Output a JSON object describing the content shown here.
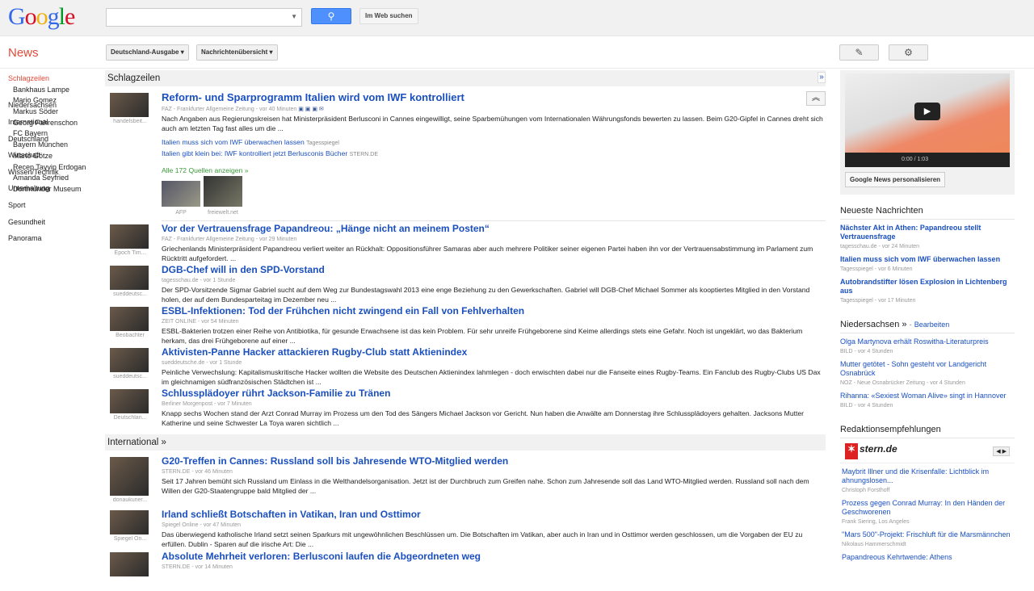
{
  "header": {
    "logo": "Google",
    "search_value": "",
    "search_button_icon": "search-icon",
    "web_search_label": "Im Web suchen"
  },
  "subbar": {
    "app_title": "News",
    "edition_label": "Deutschland-Ausgabe",
    "view_label": "Nachrichtenübersicht",
    "edit_icon": "pencil-icon",
    "settings_icon": "gear-icon"
  },
  "nav": {
    "selected": "Schlagzeilen",
    "subitems": [
      "Bankhaus Lampe",
      "Mario Gomez",
      "Markus Söder",
      "Georg Fahrenschon",
      "FC Bayern",
      "Bayern München",
      "Mario Götze",
      "Recep Tayyip Erdogan",
      "Amanda Seyfried",
      "Dortmunder Museum"
    ],
    "sections": [
      "Niedersachsen",
      "International",
      "Deutschland",
      "Wirtschaft",
      "Wissen/Technik",
      "Unterhaltung",
      "Sport",
      "Gesundheit",
      "Panorama"
    ]
  },
  "headlines": {
    "title": "Schlagzeilen",
    "more": "»",
    "lead": {
      "thumb_caption": "handelsbeit...",
      "title": "Reform- und Sparprogramm Italien wird vom IWF kontrolliert",
      "meta": "FAZ - Frankfurter Allgemeine Zeitung - vor 40 Minuten",
      "snippet": "Nach Angaben aus Regierungskreisen hat Ministerpräsident Berlusconi in Cannes eingewilligt, seine Sparbemühungen vom Internationalen Währungsfonds bewerten zu lassen. Beim G20-Gipfel in Cannes dreht sich auch am letzten Tag fast alles um die ...",
      "related": [
        {
          "title": "Italien muss sich vom IWF überwachen lassen",
          "source": "Tagesspiegel"
        },
        {
          "title": "Italien gibt klein bei: IWF kontrolliert jetzt Berlusconis Bücher",
          "source": "STERN.DE"
        }
      ],
      "all_sources": "Alle 172 Quellen anzeigen »",
      "pics": [
        "AFP",
        "freiewelt.net"
      ]
    },
    "stories": [
      {
        "thumb_caption": "Epoch Tim...",
        "title": "Vor der Vertrauensfrage Papandreou: „Hänge nicht an meinem Posten“",
        "meta": "FAZ - Frankfurter Allgemeine Zeitung - vor 29 Minuten",
        "snippet": "Griechenlands Ministerpräsident Papandreou verliert weiter an Rückhalt: Oppositionsführer Samaras aber auch mehrere Politiker seiner eigenen Partei haben ihn vor der Vertrauensabstimmung im Parlament zum Rücktritt aufgefordert. ..."
      },
      {
        "thumb_caption": "sueddeutsc...",
        "title": "DGB-Chef will in den SPD-Vorstand",
        "meta": "tagesschau.de - vor 1 Stunde",
        "snippet": "Der SPD-Vorsitzende Sigmar Gabriel sucht auf dem Weg zur Bundestagswahl 2013 eine enge Beziehung zu den Gewerkschaften. Gabriel will DGB-Chef Michael Sommer als kooptiertes Mitglied in den Vorstand holen, der auf dem Bundesparteitag im Dezember neu ..."
      },
      {
        "thumb_caption": "Beobachter",
        "title": "ESBL-Infektionen: Tod der Frühchen nicht zwingend ein Fall von Fehlverhalten",
        "meta": "ZEIT ONLINE - vor 54 Minuten",
        "snippet": "ESBL-Bakterien trotzen einer Reihe von Antibiotika, für gesunde Erwachsene ist das kein Problem. Für sehr unreife Frühgeborene sind Keime allerdings stets eine Gefahr. Noch ist ungeklärt, wo das Bakterium herkam, das drei Frühgeborene auf einer ..."
      },
      {
        "thumb_caption": "sueddeutsc...",
        "title": "Aktivisten-Panne Hacker attackieren Rugby-Club statt Aktienindex",
        "meta": "sueddeutsche.de - vor 1 Stunde",
        "snippet": "Peinliche Verwechslung: Kapitalismuskritische Hacker wollten die Website des Deutschen Aktienindex lahmlegen - doch erwischten dabei nur die Fanseite eines Rugby-Teams. Ein Fanclub des Rugby-Clubs US Dax im gleichnamigen südfranzösischen Städtchen ist ..."
      },
      {
        "thumb_caption": "Deutschlan...",
        "title": "Schlussplädoyer rührt Jackson-Familie zu Tränen",
        "meta": "Berliner Morgenpost - vor 7 Minuten",
        "snippet": "Knapp sechs Wochen stand der Arzt Conrad Murray im Prozess um den Tod des Sängers Michael Jackson vor Gericht. Nun haben die Anwälte am Donnerstag ihre Schlussplädoyers gehalten. Jacksons Mutter Katherine und seine Schwester La Toya waren sichtlich ..."
      }
    ]
  },
  "international": {
    "title": "International »",
    "stories": [
      {
        "thumb_caption": "donaukurier...",
        "title": "G20-Treffen in Cannes: Russland soll bis Jahresende WTO-Mitglied werden",
        "meta": "STERN.DE - vor 46 Minuten",
        "snippet": "Seit 17 Jahren bemüht sich Russland um Einlass in die Welthandelsorganisation. Jetzt ist der Durchbruch zum Greifen nahe. Schon zum Jahresende soll das Land WTO-Mitglied werden. Russland soll nach dem Willen der G20-Staatengruppe bald Mitglied der ..."
      },
      {
        "thumb_caption": "Spiegel On...",
        "title": "Irland schließt Botschaften in Vatikan, Iran und Osttimor",
        "meta": "Spiegel Online - vor 47 Minuten",
        "snippet": "Das überwiegend katholische Irland setzt seinen Sparkurs mit ungewöhnlichen Beschlüssen um. Die Botschaften im Vatikan, aber auch in Iran und in Osttimor werden geschlossen, um die Vorgaben der EU zu erfüllen. Dublin - Sparen auf die irische Art: Die ..."
      },
      {
        "thumb_caption": "",
        "title": "Absolute Mehrheit verloren: Berlusconi laufen die Abgeordneten weg",
        "meta": "STERN.DE - vor 14 Minuten",
        "snippet": ""
      }
    ]
  },
  "right": {
    "video": {
      "time": "0:00 / 1:03",
      "personalize": "Google News personalisieren"
    },
    "latest": {
      "title": "Neueste Nachrichten",
      "items": [
        {
          "title": "Nächster Akt in Athen: Papandreou stellt Vertrauensfrage",
          "meta": "tagesschau.de - vor 24 Minuten"
        },
        {
          "title": "Italien muss sich vom IWF überwachen lassen",
          "meta": "Tagesspiegel - vor 6 Minuten"
        },
        {
          "title": "Autobrandstifter lösen Explosion in Lichtenberg aus",
          "meta": "Tagesspiegel - vor 17 Minuten"
        }
      ]
    },
    "local": {
      "title": "Niedersachsen »",
      "edit": "Bearbeiten",
      "items": [
        {
          "title": "Olga Martynova erhält Roswitha-Literaturpreis",
          "meta": "BILD - vor 4 Stunden"
        },
        {
          "title": "Mutter getötet - Sohn gesteht vor Landgericht Osnabrück",
          "meta": "NOZ - Neue Osnabrücker Zeitung - vor 4 Stunden"
        },
        {
          "title": "Rihanna: «Sexiest Woman Alive» singt in Hannover",
          "meta": "BILD - vor 4 Stunden"
        }
      ]
    },
    "editors": {
      "title": "Redaktionsempfehlungen",
      "publisher": "stern.de",
      "items": [
        {
          "title": "Maybrit Illner und die Krisenfalle: Lichtblick im ahnungslosen...",
          "meta": "Christoph Forsthoff"
        },
        {
          "title": "Prozess gegen Conrad Murray: In den Händen der Geschworenen",
          "meta": "Frank Siering, Los Angeles"
        },
        {
          "title": "\"Mars 500\"-Projekt: Frischluft für die Marsmännchen",
          "meta": "Nikolaus Hammerschmidt"
        },
        {
          "title": "Papandreous Kehrtwende: Athens",
          "meta": ""
        }
      ]
    }
  }
}
